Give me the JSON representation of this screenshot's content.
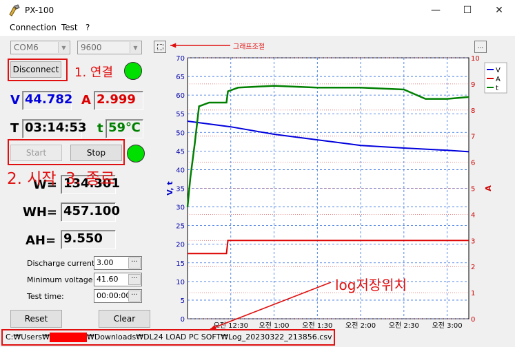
{
  "window": {
    "title": "PX-100"
  },
  "menu": [
    "Connection",
    "Test",
    "?"
  ],
  "ports": {
    "com": "COM6",
    "baud": "9600"
  },
  "buttons": {
    "disconnect": "Disconnect",
    "start": "Start",
    "stop": "Stop",
    "reset": "Reset",
    "clear": "Clear",
    "graph_settings": "...",
    "chart_menu": "..."
  },
  "readings": {
    "v_label": "V",
    "v_value": "44.782",
    "a_label": "A",
    "a_value": "2.999",
    "t_label": "T",
    "t_value": "03:14:53",
    "temp_label": "t",
    "temp_value": "59℃",
    "w_label": "W=",
    "w_value": "134.301",
    "wh_label": "WH=",
    "wh_value": "457.100",
    "ah_label": "AH=",
    "ah_value": "9.550"
  },
  "settings": {
    "discharge_label": "Discharge current",
    "discharge_value": "3.00",
    "minv_label": "Minimum voltage",
    "minv_value": "41.60",
    "testtime_label": "Test time:",
    "testtime_value": "00:00:00"
  },
  "annotations": {
    "connect": "1. 연결",
    "start": "2. 시작",
    "stop": "3. 종료",
    "graph": "그래프조절",
    "log": "log저장위치"
  },
  "status": {
    "path_prefix": "C:₩Users₩",
    "path_suffix": "₩Downloads₩DL24 LOAD PC SOFT₩Log_20230322_213856.csv"
  },
  "colors": {
    "voltage": "#0000dd",
    "current": "#dd0000",
    "temp": "#008000",
    "annotation": "#e01010",
    "led": "#00e000"
  },
  "chart_data": {
    "type": "line",
    "ylabel_left": "V, t",
    "ylabel_right": "A",
    "ylim_left": [
      0,
      70
    ],
    "ylim_right": [
      0,
      10
    ],
    "yticks_left": [
      0,
      5,
      10,
      15,
      20,
      25,
      30,
      35,
      40,
      45,
      50,
      55,
      60,
      65,
      70
    ],
    "yticks_right": [
      0,
      1,
      2,
      3,
      4,
      5,
      6,
      7,
      8,
      9,
      10
    ],
    "x_ticks": [
      "오전 12:30",
      "오전 1:00",
      "오전 1:30",
      "오전 2:00",
      "오전 2:30",
      "오전 3:00"
    ],
    "x_tick_minutes": [
      30,
      60,
      90,
      120,
      150,
      180
    ],
    "xlim_minutes": [
      0,
      195
    ],
    "legend": [
      "V",
      "A",
      "t"
    ],
    "legend_position": "top-right",
    "grid": true,
    "series": [
      {
        "name": "V",
        "axis": "left",
        "color": "#0000dd",
        "x": [
          0,
          10,
          30,
          60,
          90,
          120,
          150,
          180,
          195
        ],
        "y": [
          53,
          52.5,
          51.5,
          49.5,
          48,
          46.5,
          45.8,
          45.2,
          44.8
        ]
      },
      {
        "name": "A",
        "axis": "right",
        "color": "#dd0000",
        "x": [
          0,
          27,
          28,
          60,
          90,
          120,
          150,
          180,
          195
        ],
        "y": [
          2.5,
          2.5,
          3.0,
          3.0,
          3.0,
          3.0,
          3.0,
          3.0,
          3.0
        ]
      },
      {
        "name": "t",
        "axis": "left",
        "color": "#008000",
        "x": [
          0,
          2,
          5,
          8,
          15,
          27,
          28,
          35,
          60,
          90,
          120,
          150,
          165,
          180,
          195
        ],
        "y": [
          30,
          38,
          47,
          57,
          58,
          58,
          61,
          62,
          62.5,
          62,
          62,
          61.5,
          59,
          59,
          59.5
        ]
      }
    ]
  }
}
